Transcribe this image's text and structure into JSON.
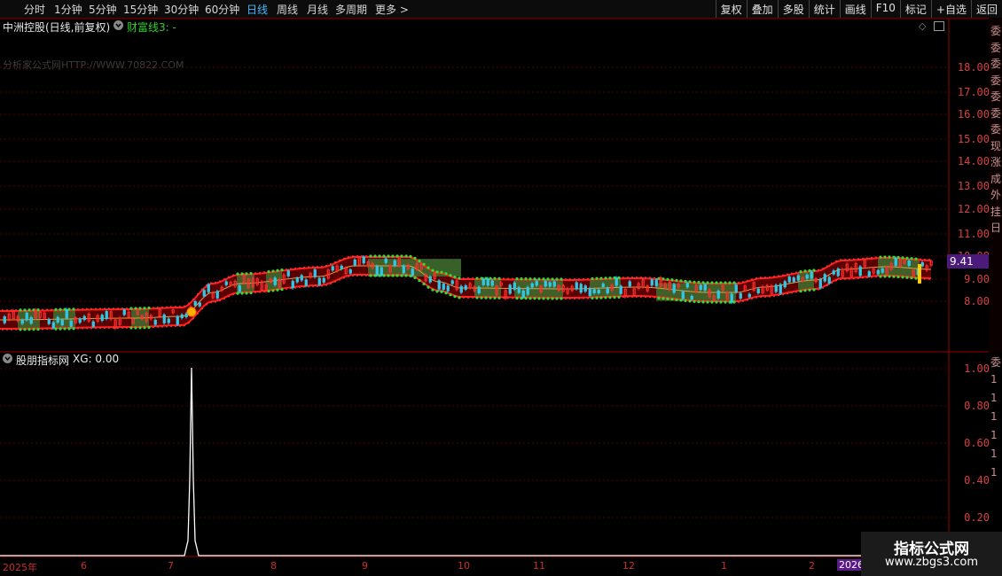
{
  "periods": [
    "分时",
    "1分钟",
    "5分钟",
    "15分钟",
    "30分钟",
    "60分钟",
    "日线",
    "周线",
    "月线",
    "多周期",
    "更多 >"
  ],
  "active_period": "日线",
  "right_buttons": [
    "复权",
    "叠加",
    "多股",
    "统计",
    "画线",
    "F10",
    "标记",
    "+自选",
    "返回"
  ],
  "stock": {
    "name": "中洲控股(日线,前复权)",
    "indicator_label": "财富线3: -"
  },
  "watermark": "分析家公式网HTTP://WWW.70822.COM",
  "price_axis": [
    "18.00",
    "17.00",
    "16.00",
    "15.00",
    "14.00",
    "13.00",
    "12.00",
    "11.00",
    "10.00",
    "9.00",
    "8.00"
  ],
  "current_price": "9.41",
  "sub_indicator": {
    "name": "股朋指标网",
    "label": "XG: 0.00"
  },
  "sub_axis": [
    "1.00",
    "0.80",
    "0.60",
    "0.40",
    "0.20"
  ],
  "date_axis": [
    "2025年",
    "6",
    "7",
    "8",
    "9",
    "10",
    "11",
    "12",
    "1",
    "2",
    "2026"
  ],
  "brand": {
    "line1": "指标公式网",
    "line2": "www.zbgs3.com"
  },
  "right_edge_chars": [
    "委",
    "委",
    "委",
    "委",
    "委",
    "委",
    "委",
    "现",
    "涨",
    "成",
    "外",
    "挂",
    "日",
    "委",
    "1",
    "1",
    "1",
    "1",
    "1",
    "1"
  ],
  "icons": {
    "toggle": "chevron-circle-icon",
    "diamond": "diamond-icon",
    "layout": "window-icon"
  }
}
